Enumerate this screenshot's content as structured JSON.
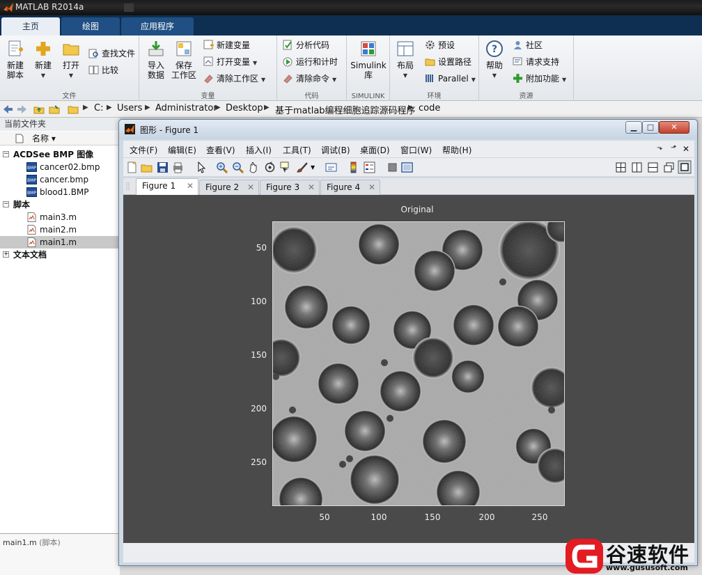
{
  "window": {
    "title": "MATLAB R2014a"
  },
  "tabs": [
    {
      "label": "主页",
      "active": true
    },
    {
      "label": "绘图"
    },
    {
      "label": "应用程序"
    }
  ],
  "ribbon": {
    "file": {
      "label": "文件",
      "new_script": "新建\n脚本",
      "new": "新建",
      "open": "打开",
      "find_files": "查找文件",
      "compare": "比较"
    },
    "variable": {
      "label": "变量",
      "import_data": "导入\n数据",
      "save_workspace": "保存\n工作区",
      "new_variable": "新建变量",
      "open_variable": "打开变量",
      "clear_workspace": "清除工作区"
    },
    "code": {
      "label": "代码",
      "analyze_code": "分析代码",
      "run_and_time": "运行和计时",
      "clear_commands": "清除命令"
    },
    "simulink": {
      "label": "SIMULINK",
      "library": "Simulink\n库"
    },
    "environment": {
      "label": "环境",
      "layout": "布局",
      "preferences": "预设",
      "set_path": "设置路径",
      "parallel": "Parallel"
    },
    "resources": {
      "label": "资源",
      "help": "帮助",
      "community": "社区",
      "request_support": "请求支持",
      "addons": "附加功能"
    }
  },
  "address": {
    "path": [
      "C:",
      "Users",
      "Administrator",
      "Desktop",
      "基于matlab编程细胞追踪源码程序",
      "code"
    ]
  },
  "current_folder": {
    "title": "当前文件夹",
    "column_name": "名称 ▾",
    "groups": [
      {
        "name": "ACDSee BMP 图像",
        "files": [
          "cancer02.bmp",
          "cancer.bmp",
          "blood1.BMP"
        ]
      },
      {
        "name": "脚本",
        "files": [
          "main3.m",
          "main2.m",
          "main1.m"
        ]
      },
      {
        "name": "文本文档",
        "files": []
      }
    ],
    "selected": "main1.m",
    "details_name": "main1.m",
    "details_type": "(脚本)"
  },
  "figure": {
    "title": "图形 - Figure 1",
    "menu": [
      "文件(F)",
      "编辑(E)",
      "查看(V)",
      "插入(I)",
      "工具(T)",
      "调试(B)",
      "桌面(D)",
      "窗口(W)",
      "帮助(H)"
    ],
    "tabs": [
      "Figure 1",
      "Figure 2",
      "Figure 3",
      "Figure 4"
    ],
    "active_tab": "Figure 1",
    "plot_title": "Original",
    "yticks": [
      "50",
      "100",
      "150",
      "200",
      "250"
    ],
    "xticks": [
      "50",
      "100",
      "150",
      "200",
      "250"
    ]
  },
  "watermark": {
    "brand": "谷速软件",
    "url": "www.gususoft.com"
  },
  "colors": {
    "tab_strip": "#0e2f52",
    "figure_canvas": "#4a4a4a",
    "watermark_red": "#e31b23"
  }
}
